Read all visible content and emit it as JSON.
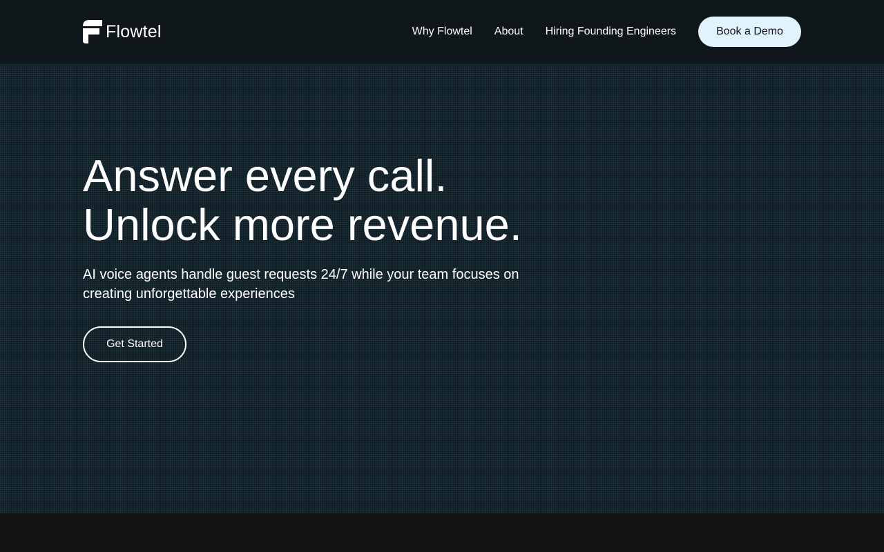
{
  "brand": {
    "name": "Flowtel"
  },
  "nav": {
    "links": [
      "Why Flowtel",
      "About",
      "Hiring Founding Engineers"
    ],
    "cta_label": "Book a Demo"
  },
  "hero": {
    "title_lines": [
      "Answer every call.",
      "Unlock more revenue."
    ],
    "subtitle": "AI voice agents handle guest requests 24/7 while your team focuses on creating unforgettable experiences",
    "cta_label": "Get Started"
  },
  "colors": {
    "header_bg": "#0f171b",
    "hero_bg": "#0f1d24",
    "demo_button_bg": "#e1f3fd",
    "page_bg": "#111111",
    "text": "#ffffff"
  }
}
